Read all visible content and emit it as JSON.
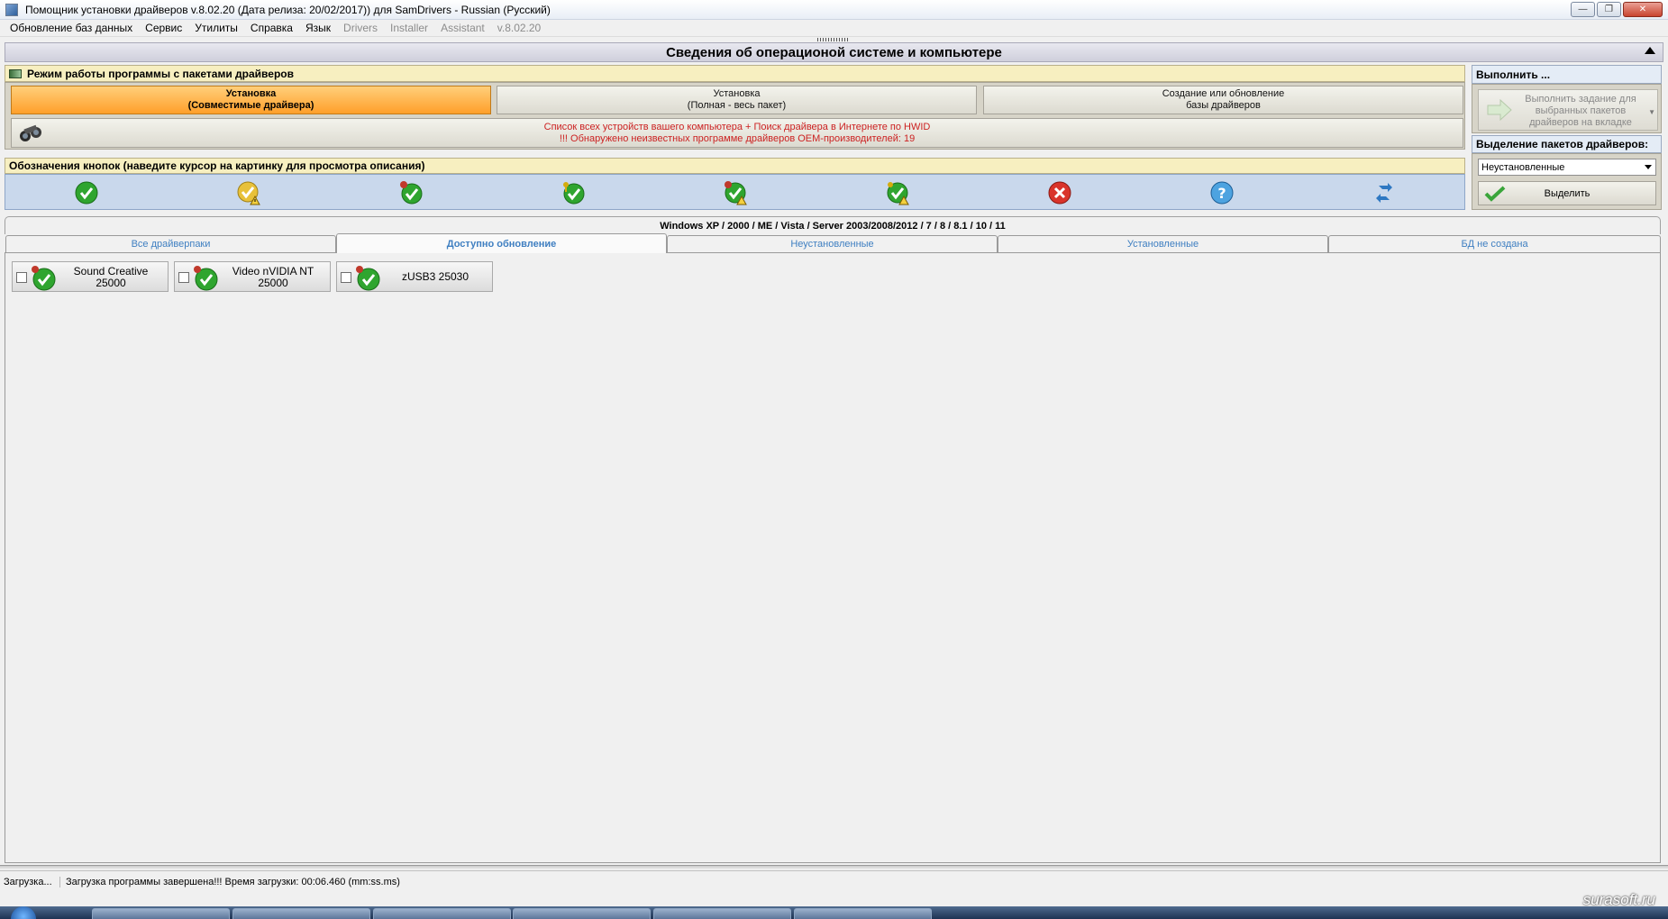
{
  "window": {
    "title": "Помощник установки драйверов v.8.02.20 (Дата релиза: 20/02/2017)) для SamDrivers - Russian (Русский)",
    "min_label": "—",
    "max_label": "❐",
    "close_label": "✕"
  },
  "menu": [
    {
      "label": "Обновление баз данных",
      "enabled": true
    },
    {
      "label": "Сервис",
      "enabled": true
    },
    {
      "label": "Утилиты",
      "enabled": true
    },
    {
      "label": "Справка",
      "enabled": true
    },
    {
      "label": "Язык",
      "enabled": true
    },
    {
      "label": "Drivers",
      "enabled": false
    },
    {
      "label": "Installer",
      "enabled": false
    },
    {
      "label": "Assistant",
      "enabled": false
    },
    {
      "label": "v.8.02.20",
      "enabled": false
    }
  ],
  "os_section": {
    "title": "Сведения об операционой системе и компьютере"
  },
  "mode_section": {
    "title": "Режим работы программы с пакетами драйверов",
    "buttons": [
      {
        "line1": "Установка",
        "line2": "(Совместимые драйвера)",
        "active": true
      },
      {
        "line1": "Установка",
        "line2": "(Полная - весь пакет)",
        "active": false
      },
      {
        "line1": "Создание или обновление",
        "line2": "базы драйверов",
        "active": false
      }
    ],
    "device_list": {
      "line1": "Список всех устройств вашего компьютера + Поиск драйвера в Интернете по HWID",
      "line2": "!!! Обнаружено неизвестных программе драйверов OEM-производителей: 19"
    }
  },
  "legend_section": {
    "title": "Обозначения кнопок (наведите курсор на картинку для просмотра описания)",
    "icons": [
      "green-check-icon",
      "yellow-check-warning-icon",
      "green-check-pinned-icon",
      "green-check-key-icon",
      "green-check-pinned-warning-icon",
      "green-check-key-warning-icon",
      "red-cross-icon",
      "blue-question-icon",
      "blue-refresh-arrows-icon"
    ]
  },
  "execute_panel": {
    "title": "Выполнить ...",
    "button": "Выполнить задание для выбранных пакетов драйверов на вкладке"
  },
  "selection_panel": {
    "title": "Выделение пакетов драйверов:",
    "selected_option": "Неустановленные",
    "button": "Выделить"
  },
  "os_tabs_header": "Windows XP / 2000 / ME / Vista / Server 2003/2008/2012 / 7 / 8 / 8.1 / 10 / 11",
  "tabs": [
    {
      "label": "Все драйверпаки",
      "active": false
    },
    {
      "label": "Доступно обновление",
      "active": true
    },
    {
      "label": "Неустановленные",
      "active": false
    },
    {
      "label": "Установленные",
      "active": false
    },
    {
      "label": "БД не создана",
      "active": false
    }
  ],
  "packages": [
    {
      "line1": "Sound Creative",
      "line2": "25000",
      "checked": false
    },
    {
      "line1": "Video nVIDIA NT",
      "line2": "25000",
      "checked": false
    },
    {
      "line1": "zUSB3 25030",
      "line2": "",
      "checked": false
    }
  ],
  "status": {
    "left": "Загрузка...",
    "message": "Загрузка программы завершена!!! Время загрузки: 00:06.460 (mm:ss.ms)"
  },
  "watermark": "surasoft.ru",
  "colors": {
    "active_mode": "#ff9f2a",
    "section_yellow": "#f7efc0",
    "legend_blue": "#c9d8ec",
    "tab_text": "#3f7fc1",
    "alert_red": "#cc2222"
  }
}
